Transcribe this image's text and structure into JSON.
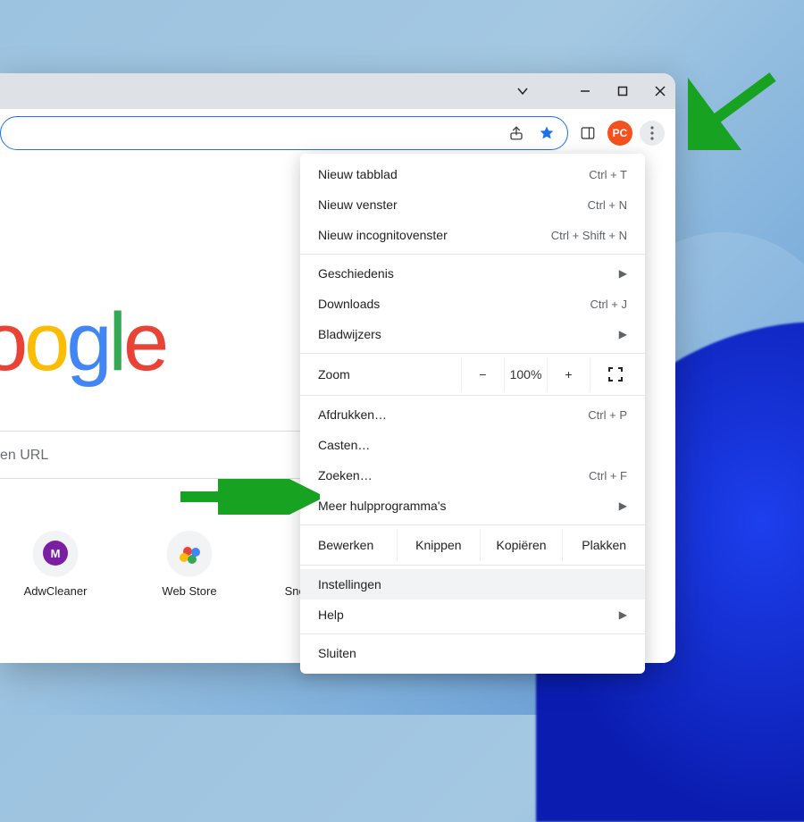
{
  "window_controls": {
    "chevron": "⌄",
    "minimize": "—",
    "maximize": "☐",
    "close": "✕"
  },
  "toolbar": {
    "avatar_initials": "PC"
  },
  "logo_letters": [
    {
      "ch": "o",
      "color": "#EA4335"
    },
    {
      "ch": "o",
      "color": "#FBBC05"
    },
    {
      "ch": "g",
      "color": "#4285F4"
    },
    {
      "ch": "l",
      "color": "#34A853"
    },
    {
      "ch": "e",
      "color": "#EA4335"
    }
  ],
  "search_placeholder_fragment": "en URL",
  "shortcuts": [
    {
      "label": "AdwCleaner",
      "kind": "m"
    },
    {
      "label": "Web Store",
      "kind": "ws"
    },
    {
      "label": "Snelle link to…",
      "kind": "plus"
    }
  ],
  "menu": {
    "new_tab": {
      "label": "Nieuw tabblad",
      "shortcut": "Ctrl + T"
    },
    "new_window": {
      "label": "Nieuw venster",
      "shortcut": "Ctrl + N"
    },
    "new_incognito": {
      "label": "Nieuw incognitovenster",
      "shortcut": "Ctrl + Shift + N"
    },
    "history": {
      "label": "Geschiedenis"
    },
    "downloads": {
      "label": "Downloads",
      "shortcut": "Ctrl + J"
    },
    "bookmarks": {
      "label": "Bladwijzers"
    },
    "zoom": {
      "label": "Zoom",
      "minus": "−",
      "value": "100%",
      "plus": "+"
    },
    "print": {
      "label": "Afdrukken…",
      "shortcut": "Ctrl + P"
    },
    "cast": {
      "label": "Casten…"
    },
    "find": {
      "label": "Zoeken…",
      "shortcut": "Ctrl + F"
    },
    "more_tools": {
      "label": "Meer hulpprogramma's"
    },
    "edit": {
      "label": "Bewerken",
      "cut": "Knippen",
      "copy": "Kopiëren",
      "paste": "Plakken"
    },
    "settings": {
      "label": "Instellingen"
    },
    "help": {
      "label": "Help"
    },
    "exit": {
      "label": "Sluiten"
    }
  }
}
